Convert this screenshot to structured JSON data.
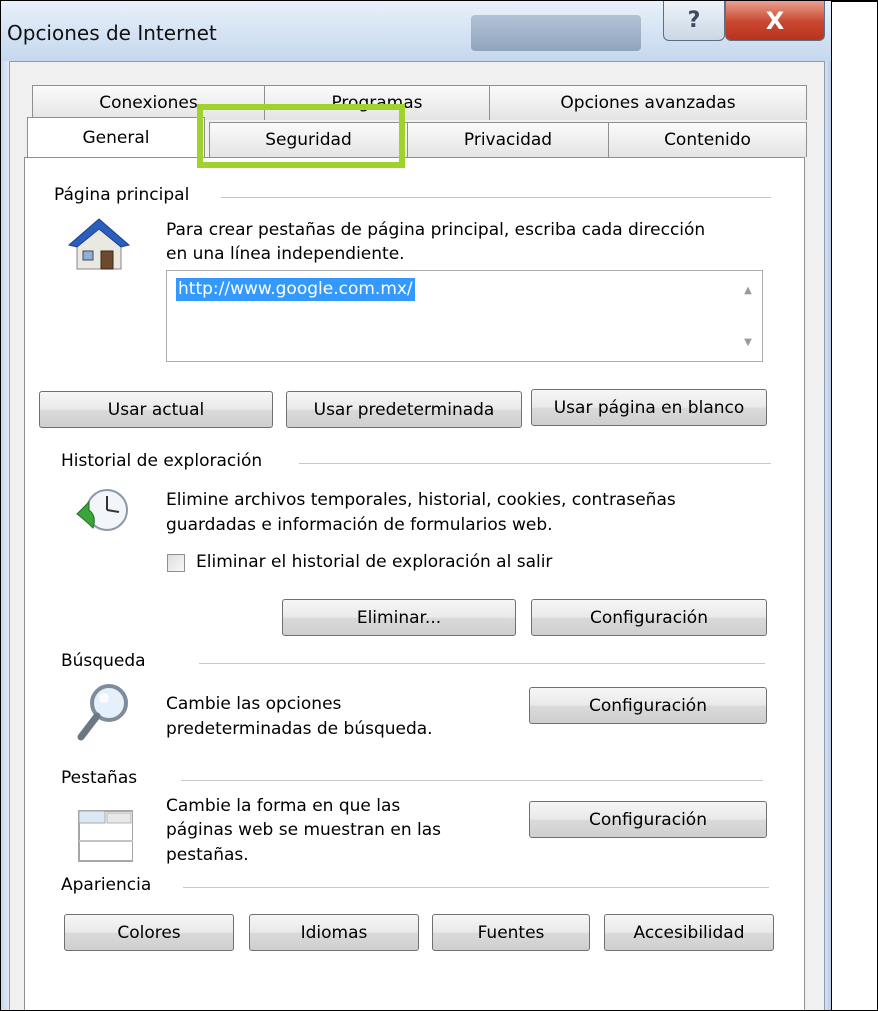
{
  "window": {
    "title": "Opciones de Internet",
    "help_label": "?",
    "close_label": "X"
  },
  "tabs": {
    "row1": [
      {
        "label": "Conexiones"
      },
      {
        "label": "Programas"
      },
      {
        "label": "Opciones avanzadas"
      }
    ],
    "row2": [
      {
        "label": "General",
        "selected": true
      },
      {
        "label": "Seguridad",
        "highlighted": true
      },
      {
        "label": "Privacidad"
      },
      {
        "label": "Contenido"
      }
    ]
  },
  "home": {
    "group_title": "Página principal",
    "description_line1": "Para crear pestañas de página principal, escriba cada dirección",
    "description_line2": "en una línea independiente.",
    "url_value": "http://www.google.com.mx/",
    "icon": "house-icon",
    "buttons": {
      "use_current": "Usar actual",
      "use_default": "Usar predeterminada",
      "use_blank": "Usar página en blanco"
    }
  },
  "history": {
    "group_title": "Historial de exploración",
    "description_line1": "Elimine archivos temporales, historial, cookies, contraseñas",
    "description_line2": "guardadas e información de formularios web.",
    "checkbox_label": "Eliminar el historial de exploración al salir",
    "checkbox_checked": false,
    "icon": "clock-arrow-icon",
    "buttons": {
      "delete": "Eliminar...",
      "settings": "Configuración"
    }
  },
  "search": {
    "group_title": "Búsqueda",
    "description_line1": "Cambie las opciones",
    "description_line2": "predeterminadas de búsqueda.",
    "icon": "magnifier-icon",
    "settings_label": "Configuración"
  },
  "tabsgroup": {
    "group_title": "Pestañas",
    "description_line1": "Cambie la forma en que las",
    "description_line2": "páginas web se muestran en las",
    "description_line3": "pestañas.",
    "icon": "tabbed-window-icon",
    "settings_label": "Configuración"
  },
  "appearance": {
    "group_title": "Apariencia",
    "buttons": {
      "colors": "Colores",
      "languages": "Idiomas",
      "fonts": "Fuentes",
      "accessibility": "Accesibilidad"
    }
  },
  "colors": {
    "highlight_box": "#9fd22b",
    "selection": "#3399ff",
    "close_button": "#c8452f"
  }
}
